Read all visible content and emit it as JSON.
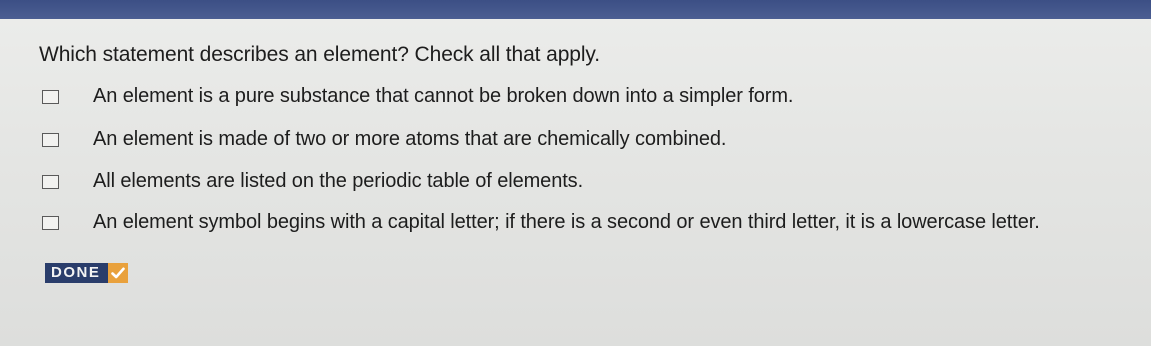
{
  "question": "Which statement describes an element? Check all that apply.",
  "options": [
    {
      "text": "An element is a pure substance that cannot be broken down into a simpler form.",
      "checked": false
    },
    {
      "text": "An element is made of two or more atoms that are chemically combined.",
      "checked": false
    },
    {
      "text": "All elements are listed on the periodic table of elements.",
      "checked": false
    },
    {
      "text": "An element symbol begins with a capital letter; if there is a second or even third letter, it is a lowercase letter.",
      "checked": false
    }
  ],
  "done_button": {
    "label": "DONE",
    "icon": "checkmark-icon"
  },
  "colors": {
    "header_bar": "#3c4f85",
    "done_background": "#2a3d6b",
    "done_check_background": "#e9a13c"
  }
}
